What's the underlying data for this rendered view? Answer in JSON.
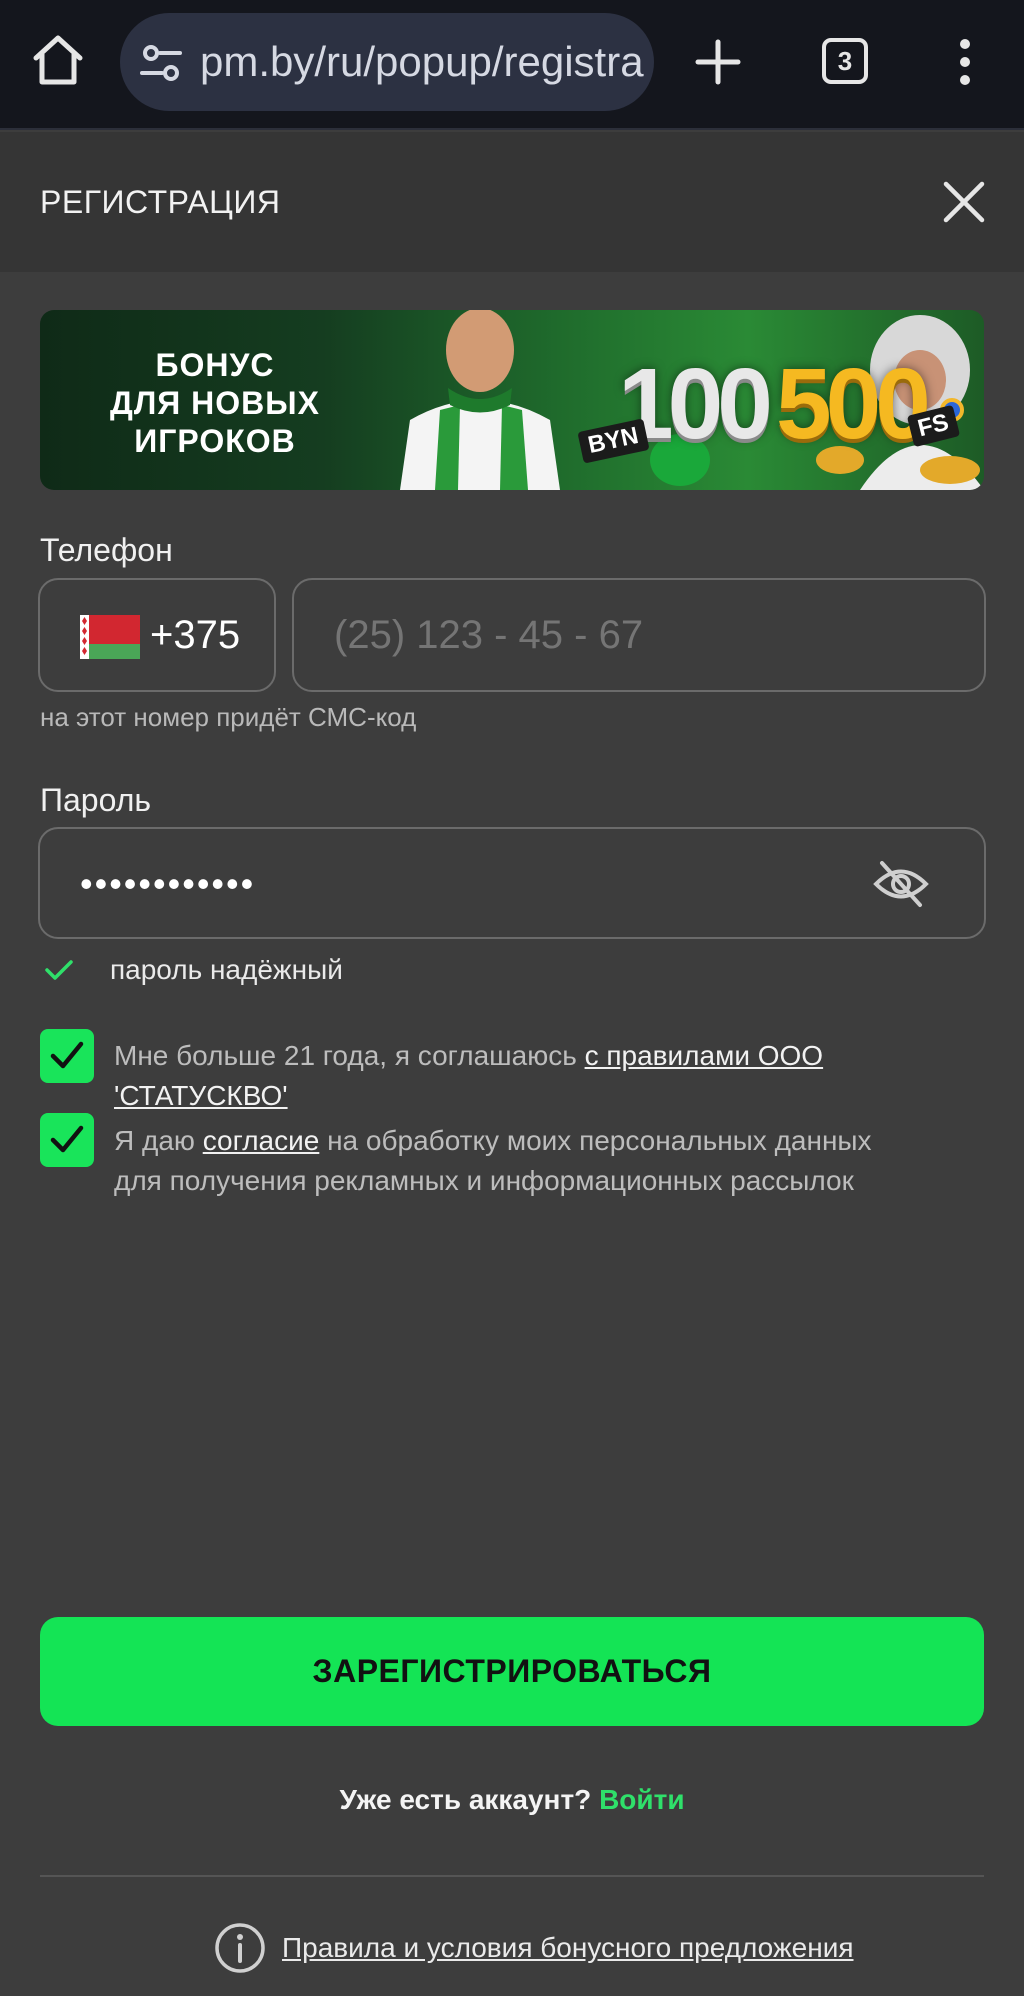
{
  "browser": {
    "url": "pm.by/ru/popup/registra",
    "tab_count": "3"
  },
  "modal": {
    "title": "РЕГИСТРАЦИЯ"
  },
  "banner": {
    "text": "БОНУС\nДЛЯ НОВЫХ\nИГРОКОВ",
    "amount_byn": "100",
    "currency": "BYN",
    "amount_fs": "500",
    "fs_label": "FS"
  },
  "phone": {
    "label": "Телефон",
    "country_code": "+375",
    "placeholder": "(25) 123 - 45 - 67",
    "hint": "на этот номер придёт СМС-код"
  },
  "password": {
    "label": "Пароль",
    "value": "••••••••••••",
    "strength": "пароль надёжный"
  },
  "consents": {
    "age": {
      "text": "Мне больше 21 года, я соглашаюсь ",
      "link": "с правилами ООО 'СТАТУСКВО'",
      "checked": true
    },
    "marketing": {
      "text_before": "Я даю ",
      "link": "согласие",
      "text_after": " на обработку моих персональных данных для получения рекламных и информационных рассылок",
      "checked": true
    }
  },
  "actions": {
    "submit": "ЗАРЕГИСТРИРОВАТЬСЯ",
    "have_account": "Уже есть аккаунт? ",
    "login": "Войти",
    "terms": "Правила и условия бонусного предложения"
  },
  "colors": {
    "accent_green": "#14e455",
    "background": "#3d3d3d",
    "header": "#353535"
  }
}
